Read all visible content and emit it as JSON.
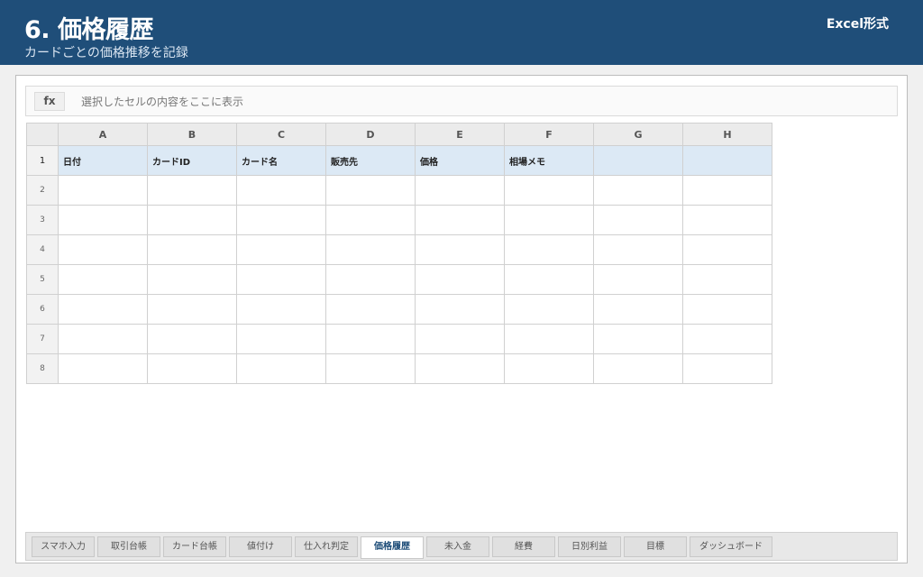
{
  "header": {
    "title": "6. 価格履歴",
    "subtitle": "カードごとの価格推移を記録",
    "format_badge": "Excel形式"
  },
  "formula_bar": {
    "fx_label": "fx",
    "placeholder": "選択したセルの内容をここに表示"
  },
  "columns": [
    "A",
    "B",
    "C",
    "D",
    "E",
    "F",
    "G",
    "H"
  ],
  "rows": [
    "1",
    "2",
    "3",
    "4",
    "5",
    "6",
    "7",
    "8"
  ],
  "header_row": [
    "日付",
    "カードID",
    "カード名",
    "販売先",
    "価格",
    "相場メモ",
    "",
    ""
  ],
  "sheet_tabs": [
    "スマホ入力",
    "取引台帳",
    "カード台帳",
    "値付け",
    "仕入れ判定",
    "価格履歴",
    "未入金",
    "経費",
    "日別利益",
    "目標",
    "ダッシュボード"
  ],
  "active_tab": "価格履歴",
  "colors": {
    "header_bg": "#1f4e79",
    "header_row_bg": "#dce9f5",
    "active_tab_text": "#1f4e79"
  }
}
